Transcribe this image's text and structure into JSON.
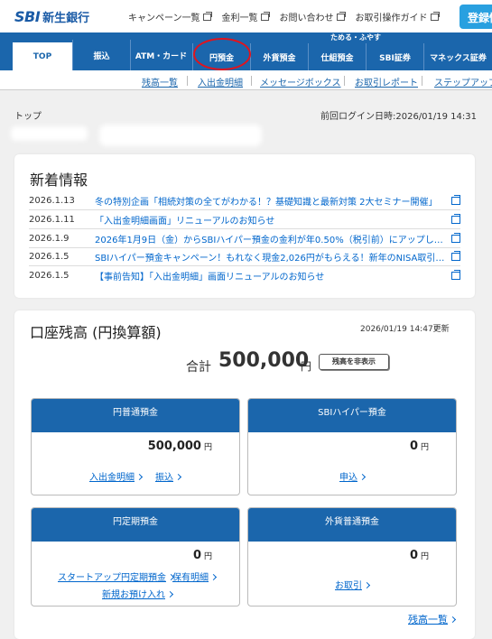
{
  "header": {
    "logo_sbi": "SBI",
    "logo_text": "新生銀行",
    "links": [
      "キャンペーン一覧",
      "金利一覧",
      "お問い合わせ",
      "お取引操作ガイド"
    ],
    "register_label": "登録情"
  },
  "nav": {
    "category_label": "ためる・ふやす",
    "items": [
      "TOP",
      "振込",
      "ATM・カード",
      "円預金",
      "外貨預金",
      "仕組預金",
      "SBI証券",
      "マネックス証券"
    ]
  },
  "subnav": {
    "items": [
      "残高一覧",
      "入出金明細",
      "メッセージボックス",
      "お取引レポート",
      "ステップアップ"
    ]
  },
  "breadcrumb": "トップ",
  "last_login": "前回ログイン日時:2026/01/19 14:31",
  "news": {
    "title": "新着情報",
    "items": [
      {
        "date": "2026.1.13",
        "title": "冬の特別企画「相続対策の全てがわかる！？基礎知識と最新対策 2大セミナー開催」"
      },
      {
        "date": "2026.1.11",
        "title": "「入出金明細画面」リニューアルのお知らせ"
      },
      {
        "date": "2026.1.9",
        "title": "2026年1月9日（金）からSBIハイパー預金の金利が年0.50%（税引前）にアップしま…"
      },
      {
        "date": "2026.1.5",
        "title": "SBIハイパー預金キャンペーン！もれなく現金2,026円がもらえる！新年のNISA取引…"
      },
      {
        "date": "2026.1.5",
        "title": "【事前告知】「入出金明細」画面リニューアルのお知らせ"
      }
    ]
  },
  "balance": {
    "title": "口座残高 (円換算額)",
    "updated": "2026/01/19 14:47更新",
    "total_label": "合計",
    "total_value": "500,000",
    "total_unit": "円",
    "hide_label": "残高を非表示",
    "yen_unit": "円",
    "accounts": {
      "yen_ordinary": {
        "title": "円普通預金",
        "amount": "500,000",
        "links": [
          "入出金明細",
          "振込"
        ]
      },
      "sbi_hyper": {
        "title": "SBIハイパー預金",
        "amount": "0",
        "links": [
          "申込"
        ]
      },
      "yen_time": {
        "title": "円定期預金",
        "amount": "0",
        "links": [
          "スタートアップ円定期預金",
          "保有明細",
          "新規お預け入れ"
        ]
      },
      "fx_ordinary": {
        "title": "外貨普通預金",
        "amount": "0",
        "links": [
          "お取引"
        ]
      }
    },
    "list_link": "残高一覧"
  },
  "colors": {
    "brand": "#1b66ac",
    "accent": "#29a0e0",
    "link": "#0066cc",
    "highlight_circle": "#e0141e"
  }
}
